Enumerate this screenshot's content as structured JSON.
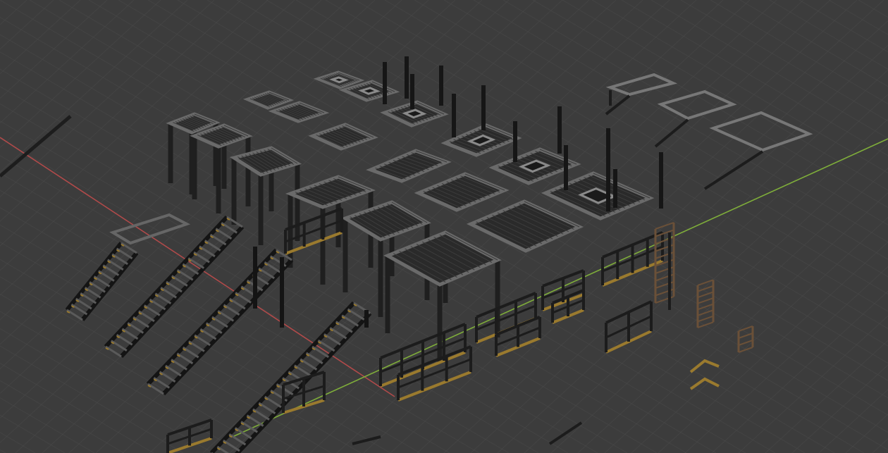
{
  "viewport": {
    "background_color": "#3c3c3c",
    "grid_color": "#4a4a4a",
    "axis_x_color": "#b04a4a",
    "axis_y_color": "#7fae3a"
  },
  "materials": {
    "metal_frame": "#1f1f1f",
    "metal_frame_edge": "#6a6a6a",
    "grate_fill": "#2a2a2a",
    "grate_line": "#3c3c3c",
    "trim_yellow": "#9a7a2e",
    "ladder_brown": "#6a5038"
  },
  "scene": {
    "object_kinds": [
      "platform-with-legs",
      "floor-grate-tile",
      "grate-tile-with-hatch",
      "frame-outline",
      "post",
      "staircase",
      "railing",
      "ladder"
    ]
  }
}
